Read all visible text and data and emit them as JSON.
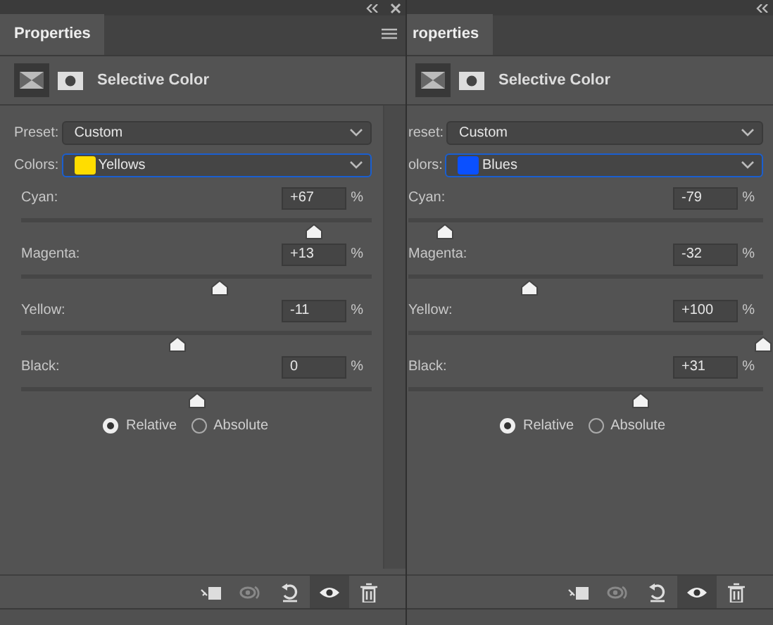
{
  "panels": [
    {
      "tab": "Properties",
      "title": "Selective Color",
      "preset_label": "Preset:",
      "preset": "Custom",
      "colors_label": "Colors:",
      "colors": {
        "value": "Yellows",
        "color": "#ffdd00"
      },
      "scrollbar": true,
      "sliders": [
        {
          "label": "Cyan:",
          "value": "+67",
          "unit": "%",
          "level": 0.835
        },
        {
          "label": "Magenta:",
          "value": "+13",
          "unit": "%",
          "level": 0.565
        },
        {
          "label": "Yellow:",
          "value": "-11",
          "unit": "%",
          "level": 0.445
        },
        {
          "label": "Black:",
          "value": "0",
          "unit": "%",
          "level": 0.5
        }
      ],
      "radios": [
        {
          "label": "Relative",
          "selected": true
        },
        {
          "label": "Absolute",
          "selected": false
        }
      ]
    },
    {
      "tab": "roperties",
      "title": "Selective Color",
      "preset_label": "reset:",
      "preset": "Custom",
      "colors_label": "olors:",
      "colors": {
        "value": "Blues",
        "color": "#0a50ff"
      },
      "scrollbar": false,
      "sliders": [
        {
          "label": "Cyan:",
          "value": "-79",
          "unit": "%",
          "level": 0.105
        },
        {
          "label": "Magenta:",
          "value": "-32",
          "unit": "%",
          "level": 0.34
        },
        {
          "label": "Yellow:",
          "value": "+100",
          "unit": "%",
          "level": 1
        },
        {
          "label": "Black:",
          "value": "+31",
          "unit": "%",
          "level": 0.655
        }
      ],
      "radios": [
        {
          "label": "Relative",
          "selected": true
        },
        {
          "label": "Absolute",
          "selected": false
        }
      ]
    }
  ]
}
